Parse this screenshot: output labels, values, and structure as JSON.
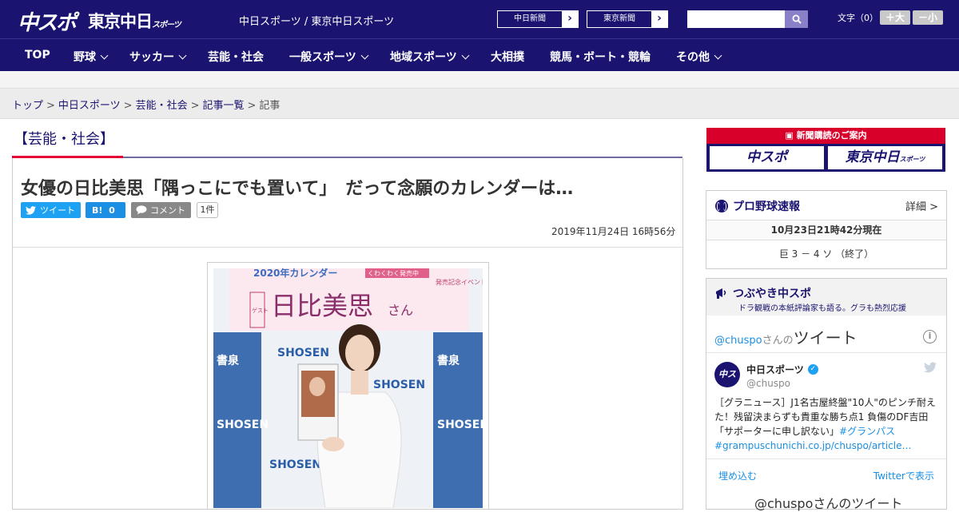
{
  "header": {
    "logo_chuspo": "中スポ",
    "logo_tokyo": "東京中日",
    "logo_tokyo_small": "スポーツ",
    "site_names": "中日スポーツ / 東京中日スポーツ",
    "ext_links": [
      {
        "label": "中日新聞"
      },
      {
        "label": "東京新聞"
      }
    ],
    "search": {
      "placeholder": "",
      "value": ""
    },
    "fontsize_label": "文字（0）",
    "fontsize_up": "＋大",
    "fontsize_down": "－小",
    "brand_color": "#1a1470"
  },
  "nav": {
    "items": [
      {
        "label": "TOP",
        "dropdown": false
      },
      {
        "label": "野球",
        "dropdown": true
      },
      {
        "label": "サッカー",
        "dropdown": true
      },
      {
        "label": "芸能・社会",
        "dropdown": false
      },
      {
        "label": "一般スポーツ",
        "dropdown": true
      },
      {
        "label": "地域スポーツ",
        "dropdown": true
      },
      {
        "label": "大相撲",
        "dropdown": false
      },
      {
        "label": "競馬・ボート・競輪",
        "dropdown": false
      },
      {
        "label": "その他",
        "dropdown": true
      }
    ]
  },
  "breadcrumb": {
    "items": [
      "トップ",
      "中日スポーツ",
      "芸能・社会",
      "記事一覧"
    ],
    "current": "記事",
    "separator": ">"
  },
  "article": {
    "section": "【芸能・社会】",
    "headline": "女優の日比美思「隅っこにでも置いて」　だって念願のカレンダーは…",
    "tweet_label": "ツイート",
    "hatena_label": "B!",
    "hatena_count": "0",
    "comment_label": "コメント",
    "comment_count": "1件",
    "date": "2019年11月24日 16時56分",
    "photo_banner_text": "2020年カレンダー",
    "photo_guest_label": "ゲスト",
    "photo_guest_name": "日比美思",
    "photo_guest_suffix": "さん",
    "photo_tag": "くわくわく発売中",
    "photo_event": "発売記念イベント",
    "photo_backdrop_text": "書泉",
    "photo_backdrop_text_latin": "SHOSEN"
  },
  "sidebar": {
    "subscribe_header": "新聞購読のご案内",
    "subscribe_logo_1": "中スポ",
    "subscribe_logo_2": "東京中日",
    "subscribe_logo_2_small": "スポーツ",
    "score": {
      "title": "プロ野球速報",
      "detail": "詳細 >",
      "time": "10月23日21時42分現在",
      "game": "巨 3 － 4 ソ （終了）"
    },
    "twitter": {
      "title": "つぶやき中スポ",
      "subtitle": "ドラ観戦の本紙評論家も語る。グラも熱烈応援",
      "handle": "@chuspo",
      "handle_suffix": "さんの",
      "handle_big": "ツイート",
      "info": "i",
      "avatar_text": "中スポ",
      "name": "中日スポーツ",
      "id": "@chuspo",
      "text": "［グラニュース］J1名古屋終盤\"10人\"のピンチ耐えた！残留決まらずも貴重な勝ち点1 負傷のDF吉田「サポーターに申し訳ない」",
      "tag1": "#グランパス",
      "tag2": "#grampus",
      "link": "chunichi.co.jp/chuspo/article…",
      "embed": "埋め込む",
      "view": "Twitterで表示",
      "bottom": "@chuspoさんのツイート"
    }
  }
}
